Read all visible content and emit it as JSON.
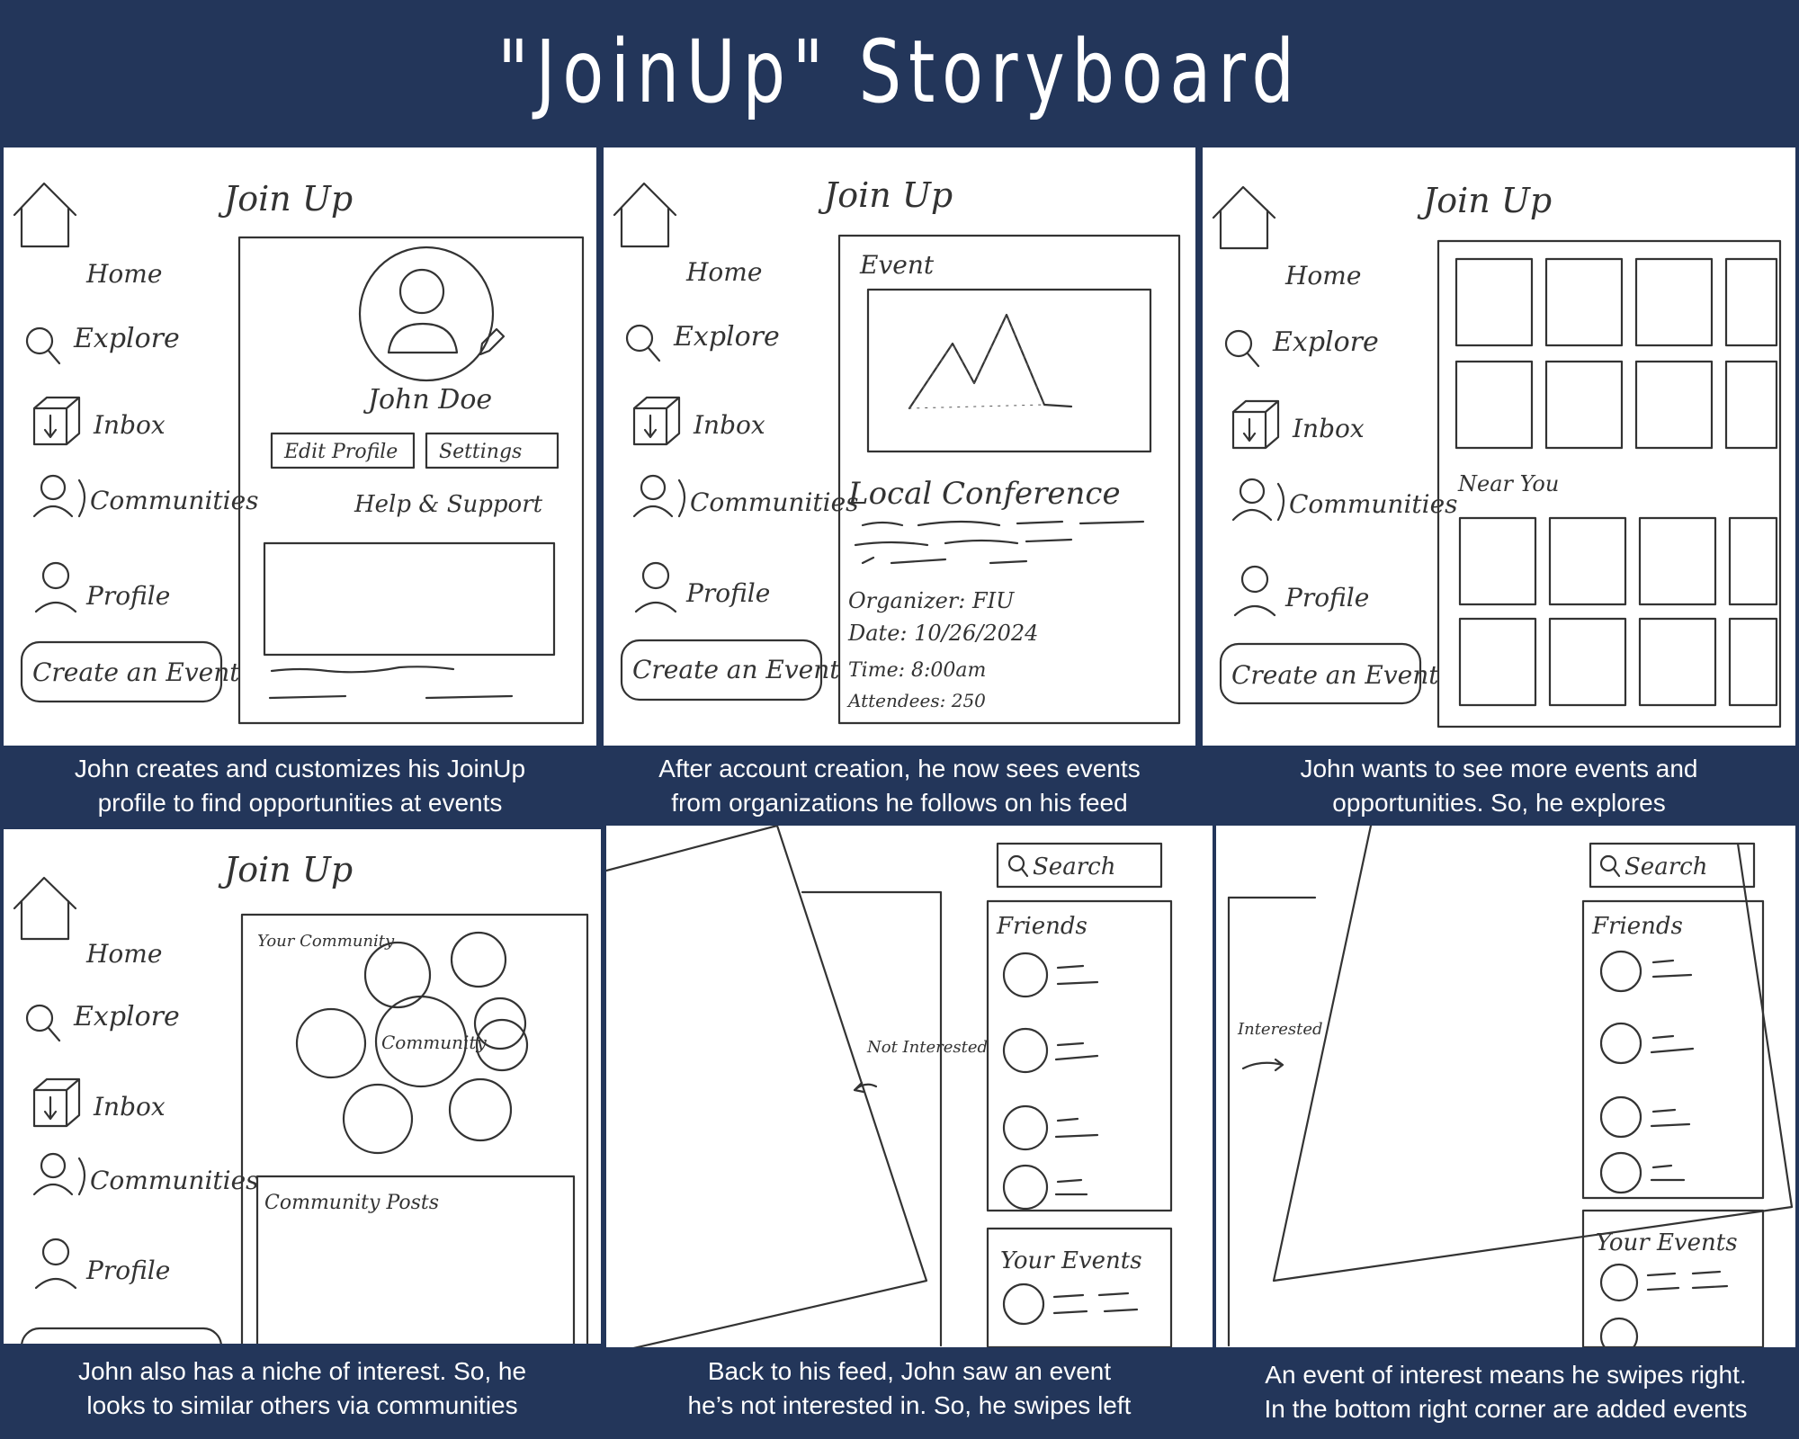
{
  "title": "\"JoinUp\" Storyboard",
  "app_name": "Join Up",
  "nav": {
    "home": "Home",
    "explore": "Explore",
    "inbox": "Inbox",
    "communities": "Communities",
    "profile": "Profile",
    "create_event": "Create an Event"
  },
  "panel1": {
    "user_name": "John Doe",
    "edit_profile": "Edit Profile",
    "settings": "Settings",
    "help": "Help & Support",
    "caption": [
      "John creates and customizes his JoinUp",
      "profile to find opportunities at events"
    ]
  },
  "panel2": {
    "heading": "Event",
    "event_title": "Local Conference",
    "organizer": "Organizer: FIU",
    "date": "Date: 10/26/2024",
    "time": "Time: 8:00am",
    "attendees": "Attendees: 250",
    "caption": [
      "After account creation, he now sees events",
      "from organizations he follows on his feed"
    ]
  },
  "panel3": {
    "near_you": "Near You",
    "caption": [
      "John wants to see more events and",
      "opportunities. So, he explores"
    ]
  },
  "panel4": {
    "your_community": "Your Community",
    "community": "Community",
    "community_posts": "Community Posts",
    "caption": [
      "John also has a niche of interest. So, he",
      "looks to similar others via communities"
    ]
  },
  "panel5": {
    "search": "Search",
    "friends": "Friends",
    "your_events": "Your Events",
    "swipe_label": "Not Interested",
    "caption": [
      "Back to his feed, John saw an event",
      "he’s not interested in. So, he swipes left"
    ]
  },
  "panel6": {
    "search": "Search",
    "friends": "Friends",
    "your_events": "Your Events",
    "swipe_label": "Interested",
    "caption": [
      "An event of interest means he swipes right.",
      "In the bottom right corner are added events"
    ]
  }
}
